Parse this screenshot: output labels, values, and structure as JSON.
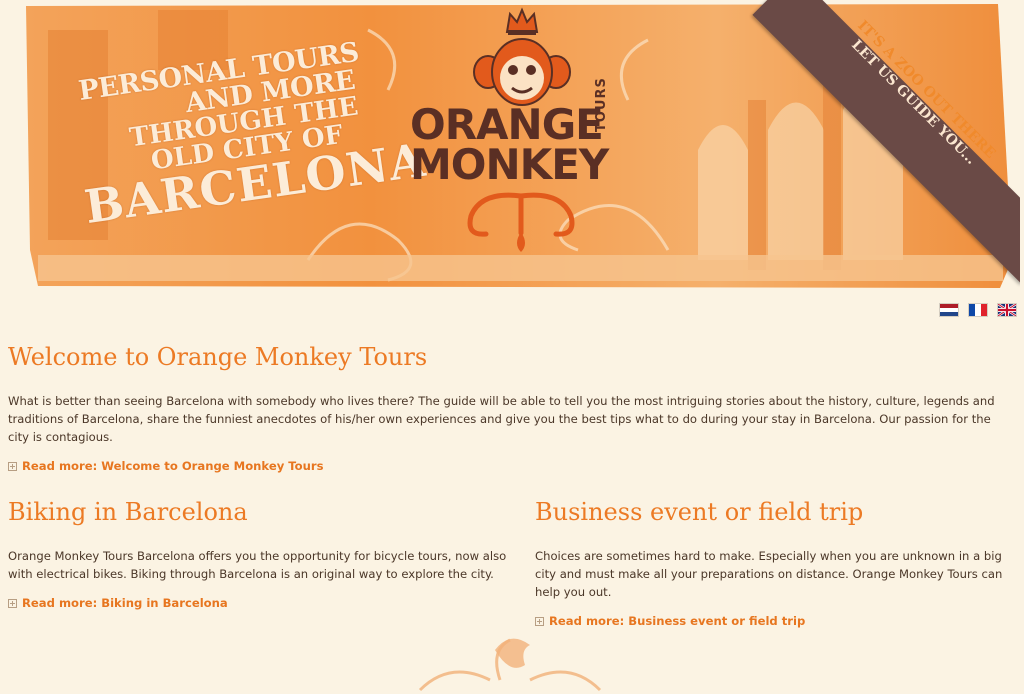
{
  "banner": {
    "tagline": [
      "PERSONAL TOURS",
      "AND MORE",
      "THROUGH THE",
      "OLD CITY OF",
      "BARCELONA"
    ],
    "logo_line1": "ORANGE",
    "logo_line2": "MONKEY",
    "logo_sub": "TOURS",
    "ribbon_line1": "IT'S A ZOO OUT THERE",
    "ribbon_line2": "LET US GUIDE YOU..."
  },
  "languages": [
    {
      "icon": "flag-netherlands-icon",
      "code": "nl"
    },
    {
      "icon": "flag-france-icon",
      "code": "fr"
    },
    {
      "icon": "flag-uk-icon",
      "code": "en"
    }
  ],
  "colors": {
    "accent": "#ec7a24",
    "link": "#e77620",
    "text": "#4b3728",
    "background": "#fbf3e3",
    "ribbon": "#6a4a46"
  },
  "welcome": {
    "title": "Welcome to Orange Monkey Tours",
    "body": "What is better than seeing Barcelona with somebody who lives there? The guide will be able to tell you the most intriguing stories about the history, culture, legends and traditions of Barcelona, share the funniest anecdotes of his/her own experiences and give you the best tips what to do during your stay in Barcelona. Our passion for the city is contagious.",
    "readmore": "Read more: Welcome to Orange Monkey Tours"
  },
  "biking": {
    "title": "Biking in Barcelona",
    "body": "Orange Monkey Tours Barcelona offers you the opportunity for bicycle tours, now also with electrical bikes. Biking through Barcelona is an original way to explore the city.",
    "readmore": "Read more: Biking in Barcelona"
  },
  "business": {
    "title": "Business event or field trip",
    "body": "Choices are sometimes hard to make. Especially when you are unknown in a big city and must make all your preparations on distance. Orange Monkey Tours can help you out.",
    "readmore": "Read more: Business event or field trip"
  }
}
